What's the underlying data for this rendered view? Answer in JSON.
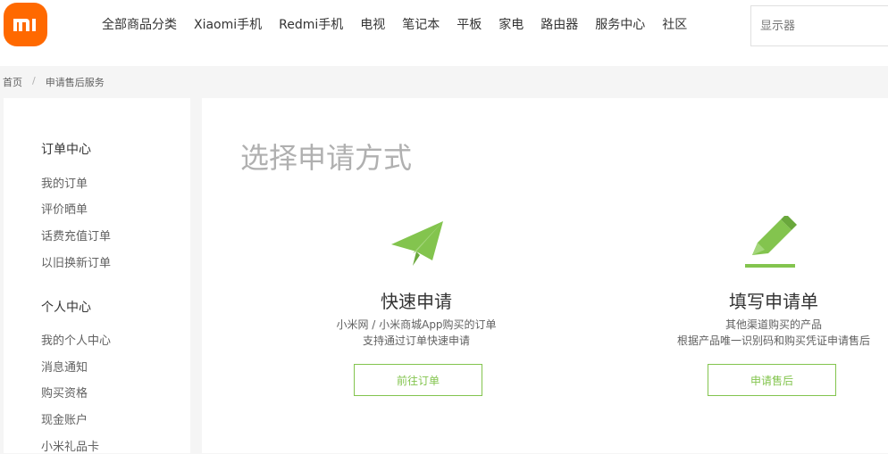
{
  "header": {
    "logo_text": "MI",
    "nav": [
      "全部商品分类",
      "Xiaomi手机",
      "Redmi手机",
      "电视",
      "笔记本",
      "平板",
      "家电",
      "路由器",
      "服务中心",
      "社区"
    ],
    "search_placeholder": "显示器"
  },
  "breadcrumb": {
    "home": "首页",
    "separator": "/",
    "current": "申请售后服务"
  },
  "sidebar": {
    "order_center": {
      "title": "订单中心",
      "items": [
        "我的订单",
        "评价晒单",
        "话费充值订单",
        "以旧换新订单"
      ]
    },
    "personal_center": {
      "title": "个人中心",
      "items": [
        "我的个人中心",
        "消息通知",
        "购买资格",
        "现金账户",
        "小米礼品卡"
      ]
    }
  },
  "main": {
    "title": "选择申请方式",
    "options": [
      {
        "icon": "paper-plane-icon",
        "title": "快速申请",
        "desc_line1": "小米网 / 小米商城App购买的订单",
        "desc_line2": "支持通过订单快速申请",
        "button": "前往订单"
      },
      {
        "icon": "pencil-icon",
        "title": "填写申请单",
        "desc_line1": "其他渠道购买的产品",
        "desc_line2": "根据产品唯一识别码和购买凭证申请售后",
        "button": "申请售后"
      }
    ]
  },
  "colors": {
    "brand": "#ff6900",
    "accent_green": "#83c44e"
  }
}
